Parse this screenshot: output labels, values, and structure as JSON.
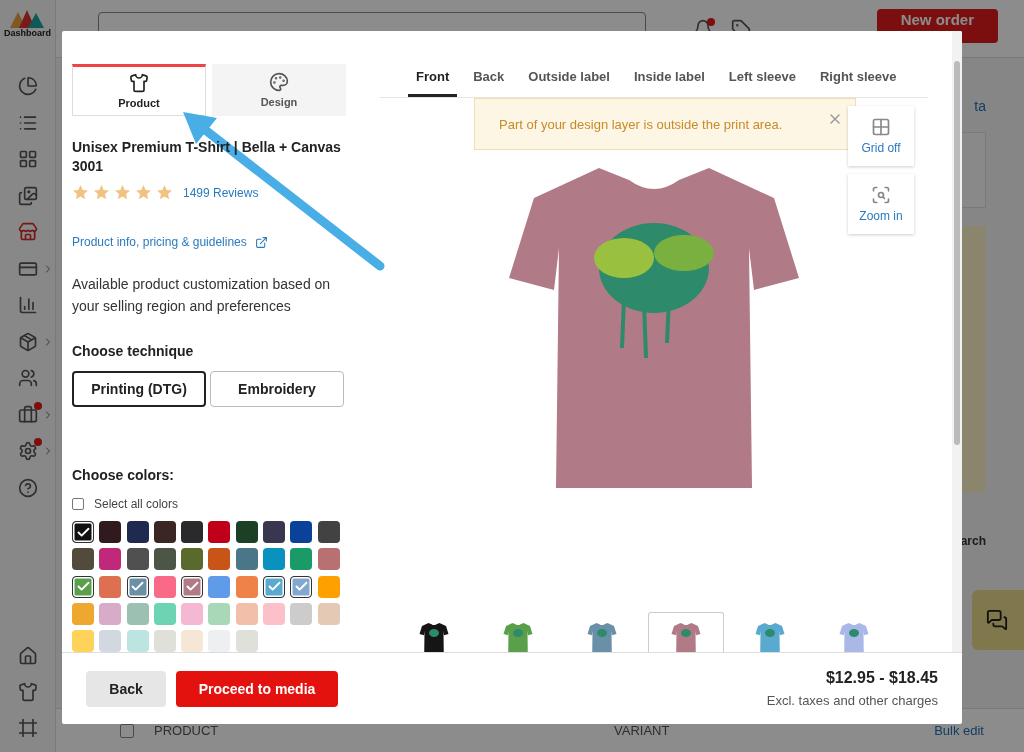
{
  "app": {
    "logo_label": "Dashboard",
    "notification_badge": true,
    "new_order": "New order",
    "sidebar_top": [
      {
        "selected": false,
        "badge": false,
        "expandable": false
      },
      {
        "selected": false,
        "badge": false,
        "expandable": false
      },
      {
        "selected": false,
        "badge": false,
        "expandable": false
      },
      {
        "selected": false,
        "badge": false,
        "expandable": false
      },
      {
        "selected": true,
        "badge": false,
        "expandable": false
      },
      {
        "selected": false,
        "badge": false,
        "expandable": true
      },
      {
        "selected": false,
        "badge": false,
        "expandable": false
      },
      {
        "selected": false,
        "badge": false,
        "expandable": true
      },
      {
        "selected": false,
        "badge": false,
        "expandable": false
      },
      {
        "selected": false,
        "badge": true,
        "expandable": true
      },
      {
        "selected": false,
        "badge": true,
        "expandable": true
      },
      {
        "selected": false,
        "badge": false,
        "expandable": false
      }
    ],
    "sidebar_bottom": [
      {
        "selected": false
      },
      {
        "selected": false
      },
      {
        "selected": false
      }
    ],
    "link_fragment": "ta",
    "text_fragment": "arch",
    "select_all_rows": {
      "checked": false
    },
    "table_columns": [
      "PRODUCT",
      "VARIANT"
    ],
    "bulk_edit": "Bulk edit"
  },
  "modal": {
    "side_tabs": [
      {
        "label": "Product",
        "selected": true
      },
      {
        "label": "Design",
        "selected": false
      }
    ],
    "product_title": "Unisex Premium T-Shirt | Bella + Canvas 3001",
    "stars": 5,
    "reviews": "1499 Reviews",
    "info_link": "Product info, pricing & guidelines",
    "description": "Available product customization based on your selling region and preferences",
    "technique_heading": "Choose technique",
    "techniques": [
      {
        "label": "Printing (DTG)",
        "selected": true
      },
      {
        "label": "Embroidery",
        "selected": false
      }
    ],
    "colors_heading": "Choose colors:",
    "select_all": {
      "label": "Select all colors",
      "checked": false
    },
    "swatches": [
      {
        "color": "#111111",
        "selected": true
      },
      {
        "color": "#311a1e",
        "selected": false
      },
      {
        "color": "#1e2a4e",
        "selected": false
      },
      {
        "color": "#3a2622",
        "selected": false
      },
      {
        "color": "#2a2a2c",
        "selected": false
      },
      {
        "color": "#c00018",
        "selected": false
      },
      {
        "color": "#1c3f26",
        "selected": false
      },
      {
        "color": "#393650",
        "selected": false
      },
      {
        "color": "#0a429a",
        "selected": false
      },
      {
        "color": "#424242",
        "selected": false
      },
      {
        "color": "#524a3a",
        "selected": false
      },
      {
        "color": "#c0287a",
        "selected": false
      },
      {
        "color": "#505050",
        "selected": false
      },
      {
        "color": "#4d5546",
        "selected": false
      },
      {
        "color": "#5a6a2c",
        "selected": false
      },
      {
        "color": "#c85418",
        "selected": false
      },
      {
        "color": "#4a7688",
        "selected": false
      },
      {
        "color": "#0892bd",
        "selected": false
      },
      {
        "color": "#1a9a66",
        "selected": false
      },
      {
        "color": "#b87070",
        "selected": false
      },
      {
        "color": "#5aa04a",
        "selected": true
      },
      {
        "color": "#dc7050",
        "selected": false
      },
      {
        "color": "#6a90a8",
        "selected": true
      },
      {
        "color": "#f86a88",
        "selected": false
      },
      {
        "color": "#b07a86",
        "selected": true
      },
      {
        "color": "#5f9be8",
        "selected": false
      },
      {
        "color": "#ee8248",
        "selected": false
      },
      {
        "color": "#5aaad0",
        "selected": true
      },
      {
        "color": "#82a8d0",
        "selected": true
      },
      {
        "color": "#fea000",
        "selected": false
      },
      {
        "color": "#eea830",
        "selected": false
      },
      {
        "color": "#d8acc8",
        "selected": false
      },
      {
        "color": "#9cc0b2",
        "selected": false
      },
      {
        "color": "#6cd4b2",
        "selected": false
      },
      {
        "color": "#f4b8d2",
        "selected": false
      },
      {
        "color": "#a8d8b8",
        "selected": false
      },
      {
        "color": "#f2c0aa",
        "selected": false
      },
      {
        "color": "#fcc0c8",
        "selected": false
      },
      {
        "color": "#cccccc",
        "selected": false
      },
      {
        "color": "#e4cab4",
        "selected": false
      },
      {
        "color": "#ffd25a",
        "selected": false
      },
      {
        "color": "#d2d8e2",
        "selected": false
      },
      {
        "color": "#bce4e0",
        "selected": false
      },
      {
        "color": "#e0e0da",
        "selected": false
      },
      {
        "color": "#f6e6d6",
        "selected": false
      },
      {
        "color": "#eeeff0",
        "selected": false
      },
      {
        "color": "#e0e0da",
        "selected": false
      }
    ],
    "view_tabs": [
      {
        "label": "Front",
        "selected": true
      },
      {
        "label": "Back",
        "selected": false
      },
      {
        "label": "Outside label",
        "selected": false
      },
      {
        "label": "Inside label",
        "selected": false
      },
      {
        "label": "Left sleeve",
        "selected": false
      },
      {
        "label": "Right sleeve",
        "selected": false
      }
    ],
    "alert": "Part of your design layer is outside the print area.",
    "tools": [
      {
        "kind": "grid",
        "label": "Grid off"
      },
      {
        "kind": "zoom",
        "label": "Zoom in"
      }
    ],
    "thumbnails": [
      {
        "color": "#151515",
        "selected": false
      },
      {
        "color": "#5aa04a",
        "selected": false
      },
      {
        "color": "#6a90a8",
        "selected": false
      },
      {
        "color": "#b07a86",
        "selected": true
      },
      {
        "color": "#5aaad0",
        "selected": false
      },
      {
        "color": "#aab8e8",
        "selected": false
      }
    ],
    "back": "Back",
    "proceed": "Proceed to media",
    "price": "$12.95 - $18.45",
    "price_note": "Excl. taxes and other charges"
  }
}
